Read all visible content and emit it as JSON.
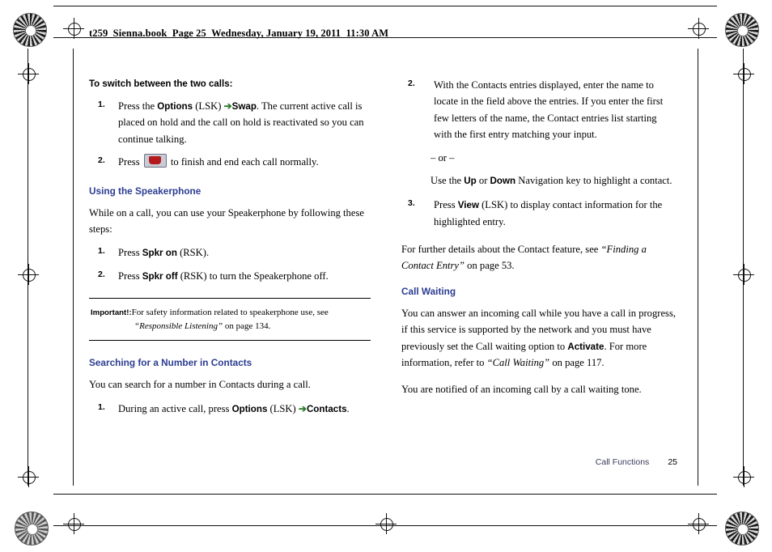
{
  "header": {
    "text": "t259_Sienna.book  Page 25  Wednesday, January 19, 2011  11:30 AM"
  },
  "left_column": {
    "heading_switch": "To switch between the two calls:",
    "step1": {
      "num": "1.",
      "pre": "Press the ",
      "kw1": "Options",
      "mid1": " (LSK) ",
      "arrow": "➔",
      "kw2": "Swap",
      "post": ". The current active call is placed on hold and the call on hold is reactivated so you can continue talking."
    },
    "step2": {
      "num": "2.",
      "pre": "Press ",
      "icon": "end-call-key-icon",
      "post": " to finish and end each call normally."
    },
    "heading_speakerphone": "Using the Speakerphone",
    "speakerphone_intro": "While on a call, you can use your Speakerphone by following these steps:",
    "spkr_step1": {
      "num": "1.",
      "pre": "Press ",
      "kw": "Spkr on",
      "post": " (RSK)."
    },
    "spkr_step2": {
      "num": "2.",
      "pre": "Press ",
      "kw": "Spkr off",
      "post": " (RSK) to turn the Speakerphone off."
    },
    "note": {
      "label": "Important!:",
      "text": "For safety information related to speakerphone use, see",
      "ref": "“Responsible Listening”",
      "ref_tail": " on page 134."
    },
    "heading_search": "Searching for a Number in Contacts",
    "search_intro": "You can search for a number in Contacts during a call.",
    "search_step1": {
      "num": "1.",
      "pre": "During an active call, press ",
      "kw1": "Options",
      "mid1": " (LSK) ",
      "arrow": "➔",
      "kw2": "Contacts",
      "post": "."
    }
  },
  "right_column": {
    "step2": {
      "num": "2.",
      "text": "With the Contacts entries displayed, enter the name to locate in the field above the entries. If you enter the first few letters of the name, the Contact entries list starting with the first entry matching your input."
    },
    "or_line": "– or –",
    "or_body": {
      "pre": "Use the ",
      "kw1": "Up",
      "mid": " or ",
      "kw2": "Down",
      "post": " Navigation key to highlight a contact."
    },
    "step3": {
      "num": "3.",
      "pre": "Press ",
      "kw": "View",
      "post": " (LSK) to display contact information for the highlighted entry."
    },
    "details_para": {
      "pre": "For further details about the Contact feature, see ",
      "ref": "“Finding a Contact Entry”",
      "post": " on page 53."
    },
    "heading_call_waiting": "Call Waiting",
    "cw_para1": {
      "pre": "You can answer an incoming call while you have a call in progress, if this service is supported by the network and you must have previously set the Call waiting option to ",
      "kw": "Activate",
      "mid": ". For more information, refer to ",
      "ref": "“Call Waiting”",
      "post": "  on page 117."
    },
    "cw_para2": "You are notified of an incoming call by a call waiting tone."
  },
  "footer": {
    "section": "Call Functions",
    "page": "25"
  },
  "colors": {
    "heading_blue": "#2b3d91",
    "arrow_green": "#2b7a2b",
    "footer_blue": "#3a3a5c",
    "endkey_red": "#b4191d"
  }
}
